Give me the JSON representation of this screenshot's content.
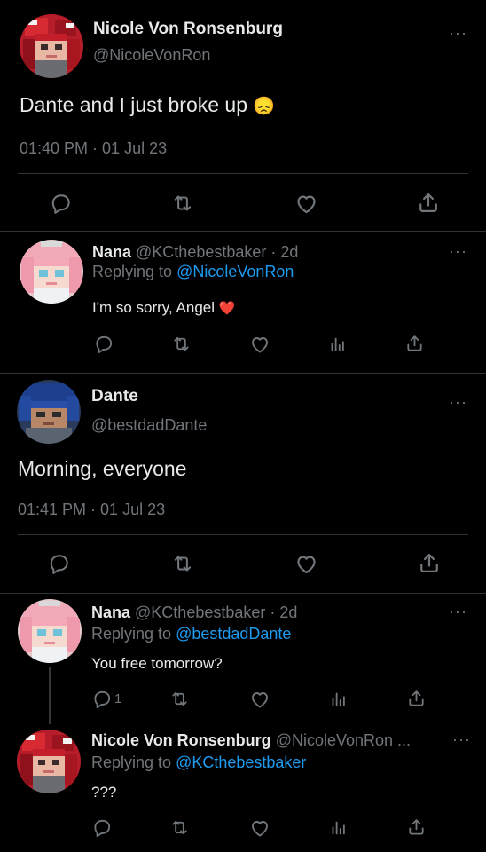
{
  "tweet1": {
    "name": "Nicole Von Ronsenburg",
    "handle": "@NicoleVonRon",
    "text": "Dante and I just broke up",
    "emoji": "😞",
    "time": "01:40 PM · 01 Jul 23"
  },
  "reply1": {
    "name": "Nana",
    "handle_time": "@KCthebestbaker · 2d",
    "replying_prefix": "Replying to",
    "replying_to": "@NicoleVonRon",
    "text": "I'm so sorry, Angel",
    "emoji": "❤️"
  },
  "tweet2": {
    "name": "Dante",
    "handle": "@bestdadDante",
    "text": "Morning, everyone",
    "time": "01:41 PM · 01 Jul 23"
  },
  "reply2": {
    "name": "Nana",
    "handle_time": "@KCthebestbaker · 2d",
    "replying_prefix": "Replying to",
    "replying_to": "@bestdadDante",
    "text": "You free tomorrow?",
    "reply_count": "1"
  },
  "reply3": {
    "name": "Nicole Von Ronsenburg",
    "handle_time": "@NicoleVonRon ...",
    "replying_prefix": "Replying to",
    "replying_to": "@KCthebestbaker",
    "text": "???"
  },
  "more_glyph": "···",
  "colors": {
    "background": "#000000",
    "text": "#e7e9ea",
    "muted": "#71767b",
    "link": "#1d9bf0",
    "divider": "#2f3336",
    "heart": "#e0245e"
  }
}
